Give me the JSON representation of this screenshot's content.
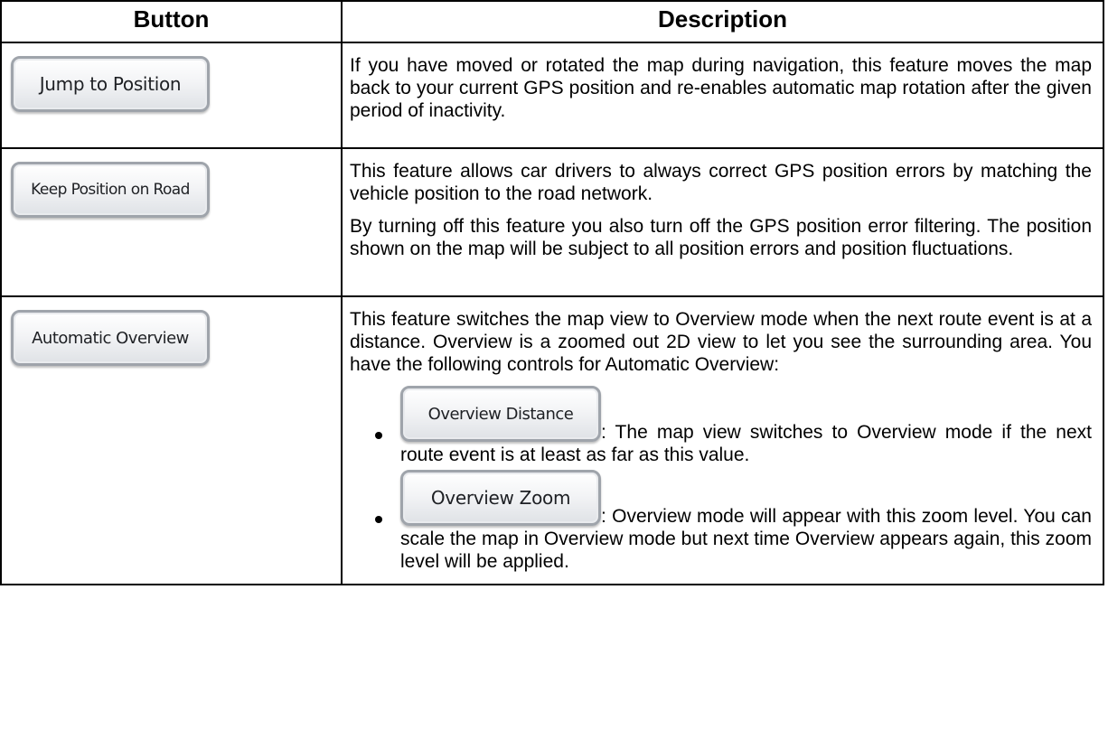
{
  "header": {
    "button_col": "Button",
    "description_col": "Description"
  },
  "rows": [
    {
      "button_label": "Jump to Position",
      "paragraphs": [
        "If you have moved or rotated the map during navigation, this feature moves the map back to your current GPS position and re-enables automatic map rotation after the given period of inactivity."
      ]
    },
    {
      "button_label": "Keep Position on Road",
      "paragraphs": [
        "This feature allows car drivers to always correct GPS position errors by matching the vehicle position to the road network.",
        "By turning off this feature you also turn off the GPS position error filtering. The position shown on the map will be subject to all position errors and position fluctuations."
      ]
    },
    {
      "button_label": "Automatic Overview",
      "paragraphs": [
        "This feature switches the map view to Overview mode when the next route event is at a distance. Overview is a zoomed out 2D view to let you see the surrounding area. You have the following controls for Automatic Overview:"
      ],
      "controls": [
        {
          "button_label": "Overview Distance",
          "text": ": The map view switches to Overview mode if the next route event is at least as far as this value."
        },
        {
          "button_label": "Overview Zoom",
          "text": ": Overview mode will appear with this zoom level. You can scale the map in Overview mode but next time Overview appears again, this zoom level will be applied."
        }
      ]
    }
  ]
}
